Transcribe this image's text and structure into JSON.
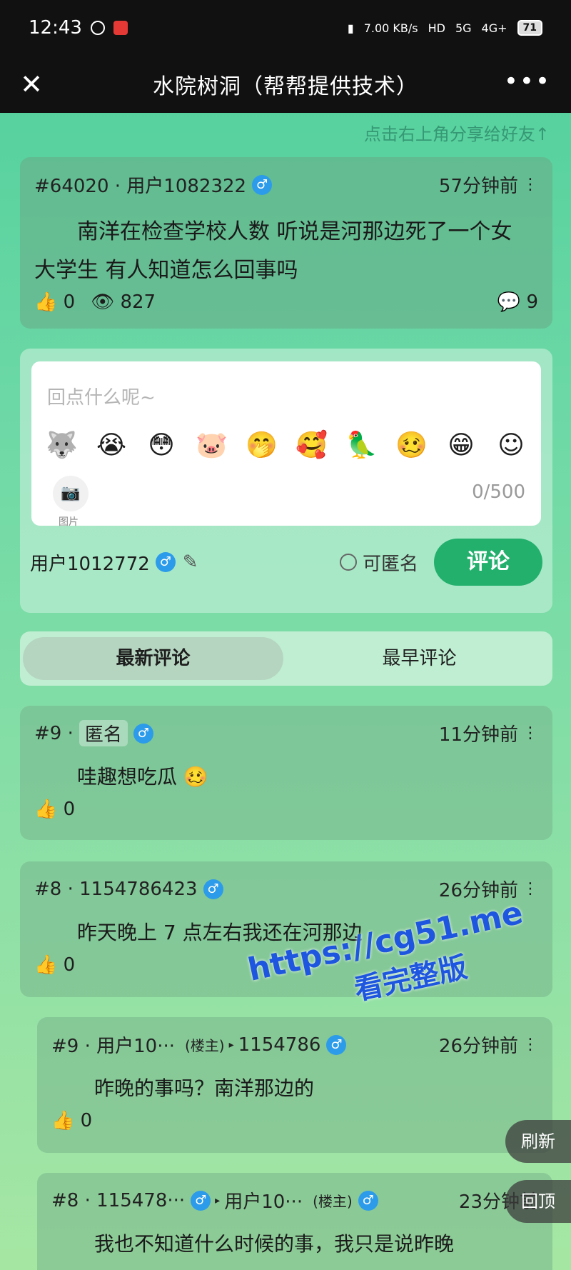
{
  "status_bar": {
    "time": "12:43",
    "net_speed": "7.00 KB/s",
    "hd": "HD",
    "net5g": "5G",
    "net4g": "4G+",
    "battery": "71"
  },
  "nav": {
    "close": "✕",
    "title": "水院树洞（帮帮提供技术）",
    "more": "•••"
  },
  "share_tip": "点击右上角分享给好友↑",
  "post": {
    "meta": "#64020 · 用户1082322",
    "time": "57分钟前",
    "content": "南洋在检查学校人数 听说是河那边死了一个女大学生 有人知道怎么回事吗",
    "likes": "0",
    "views": "827",
    "comments": "9"
  },
  "reply": {
    "placeholder": "回点什么呢~",
    "emojis": [
      "🐺",
      "😭",
      "😳",
      "🐷",
      "🤭",
      "🥰",
      "🦜",
      "🥴",
      "😁",
      "☺"
    ],
    "photo_label": "图片",
    "char_count": "0/500",
    "username": "用户1012772",
    "anonymous_label": "可匿名",
    "submit_label": "评论"
  },
  "tabs": {
    "newest": "最新评论",
    "earliest": "最早评论"
  },
  "comments": [
    {
      "id": "#9 ·",
      "user": "匿名",
      "time": "11分钟前",
      "content": "哇趣想吃瓜 🥴",
      "likes": "0"
    },
    {
      "id": "#8 · 1154786423",
      "time": "26分钟前",
      "content": "昨天晚上 7 点左右我还在河那边",
      "likes": "0"
    }
  ],
  "sub_replies": [
    {
      "id": "#9 · 用户10···",
      "louzhu": "(楼主)",
      "reply_to": "1154786",
      "time": "26分钟前",
      "content": "昨晚的事吗？南洋那边的",
      "likes": "0"
    },
    {
      "id": "#8 · 115478···",
      "reply_to": "用户10···",
      "louzhu": "(楼主)",
      "time": "23分钟前",
      "content": "我也不知道什么时候的事，我只是说昨晚"
    }
  ],
  "watermark": {
    "line1": "https://cg51.me",
    "line2": "看完整版"
  },
  "float_buttons": {
    "refresh": "刷新",
    "top": "回顶"
  }
}
